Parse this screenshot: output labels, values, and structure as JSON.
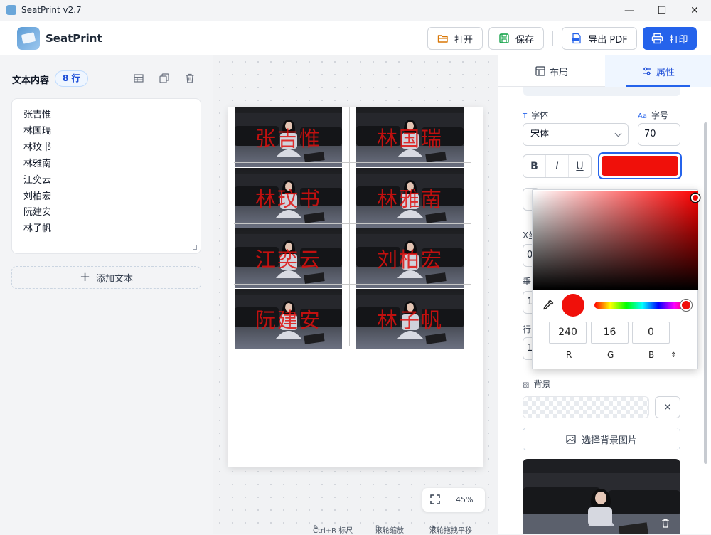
{
  "window": {
    "title": "SeatPrint v2.7",
    "minimize": "—",
    "maximize": "☐",
    "close": "✕"
  },
  "header": {
    "brand": "SeatPrint",
    "open_label": "打开",
    "save_label": "保存",
    "export_pdf_label": "导出 PDF",
    "print_label": "打印"
  },
  "left_panel": {
    "title": "文本内容",
    "count_badge": "8 行",
    "lines": [
      "张吉惟",
      "林国瑞",
      "林玟书",
      "林雅南",
      "江奕云",
      "刘柏宏",
      "阮建安",
      "林子帆"
    ],
    "add_text_label": "添加文本"
  },
  "canvas": {
    "cells": [
      "张吉惟",
      "林国瑞",
      "林玟书",
      "林雅南",
      "江奕云",
      "刘柏宏",
      "阮建安",
      "林子帆"
    ],
    "zoom": "45%"
  },
  "status_bar": {
    "ruler_hint": "Ctrl+R 标尺",
    "zoom_hint": "滚轮缩放",
    "pan_hint": "滚轮拖拽平移"
  },
  "right_panel": {
    "tabs": [
      {
        "label": "布局"
      },
      {
        "label": "属性"
      }
    ],
    "font": {
      "label": "字体",
      "value": "宋体"
    },
    "size": {
      "label": "字号",
      "value": "70"
    },
    "format_buttons": [
      "B",
      "I",
      "U"
    ],
    "text_color": "#f0100a",
    "partially_hidden_labels": [
      "X坐",
      "垂",
      "行"
    ],
    "partially_hidden_values": [
      "0",
      "1",
      "1"
    ],
    "background": {
      "label": "背景",
      "clear": "✕",
      "choose_label": "选择背景图片"
    }
  },
  "color_picker": {
    "hue_color": "#ff0000",
    "current_color": "#f0100a",
    "r": "240",
    "g": "16",
    "b": "0",
    "r_label": "R",
    "g_label": "G",
    "b_label": "B",
    "mode_toggle": "⇕"
  },
  "colors": {
    "accent": "#2563eb",
    "text_red": "#e0100e"
  }
}
